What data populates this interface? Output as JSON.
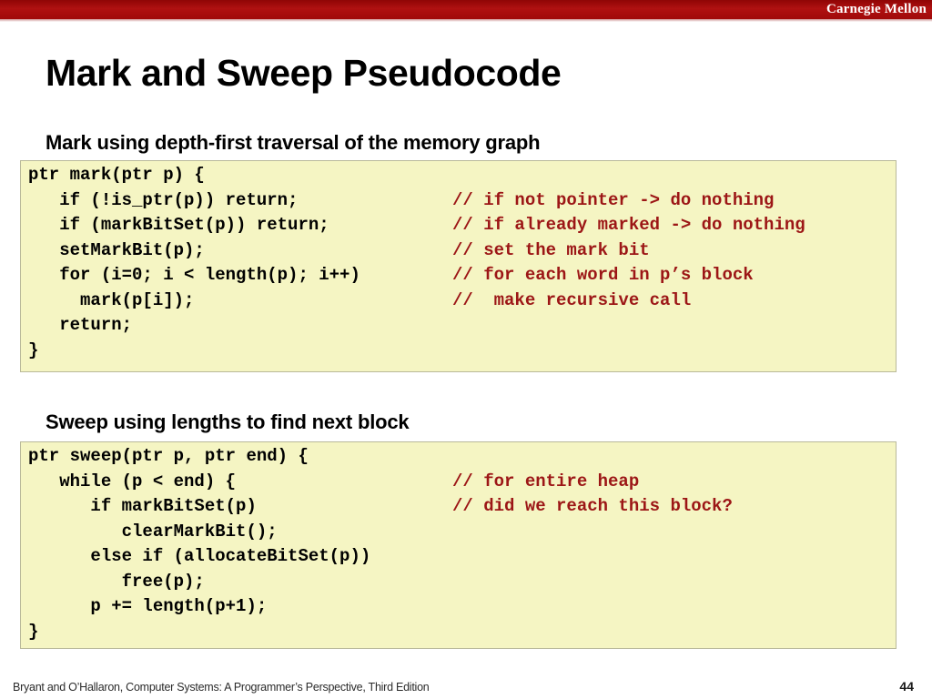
{
  "banner": {
    "institution": "Carnegie Mellon",
    "color": "#a50a0a"
  },
  "slide": {
    "title": "Mark and Sweep Pseudocode",
    "heading_mark": "Mark using depth-first traversal of the memory graph",
    "heading_sweep": "Sweep using lengths to find next block"
  },
  "code_mark": {
    "background": "#f5f5c3",
    "comment_color": "#9c1616",
    "lines": [
      {
        "code": "ptr mark(ptr p) {",
        "comment": ""
      },
      {
        "code": "   if (!is_ptr(p)) return;",
        "comment": "// if not pointer -> do nothing"
      },
      {
        "code": "   if (markBitSet(p)) return;",
        "comment": "// if already marked -> do nothing"
      },
      {
        "code": "   setMarkBit(p);",
        "comment": "// set the mark bit"
      },
      {
        "code": "   for (i=0; i < length(p); i++)",
        "comment": "// for each word in p’s block"
      },
      {
        "code": "     mark(p[i]);",
        "comment": "//  make recursive call"
      },
      {
        "code": "   return;",
        "comment": ""
      },
      {
        "code": "}",
        "comment": ""
      }
    ]
  },
  "code_sweep": {
    "background": "#f5f5c3",
    "comment_color": "#9c1616",
    "lines": [
      {
        "code": "ptr sweep(ptr p, ptr end) {",
        "comment": ""
      },
      {
        "code": "   while (p < end) {",
        "comment": "// for entire heap"
      },
      {
        "code": "      if markBitSet(p)",
        "comment": "// did we reach this block?"
      },
      {
        "code": "         clearMarkBit();",
        "comment": ""
      },
      {
        "code": "      else if (allocateBitSet(p))",
        "comment": ""
      },
      {
        "code": "         free(p);",
        "comment": ""
      },
      {
        "code": "      p += length(p+1);",
        "comment": ""
      },
      {
        "code": "}",
        "comment": ""
      }
    ]
  },
  "footer": {
    "attribution": "Bryant and O’Hallaron, Computer Systems: A Programmer’s Perspective, Third Edition",
    "page_number": "44"
  }
}
